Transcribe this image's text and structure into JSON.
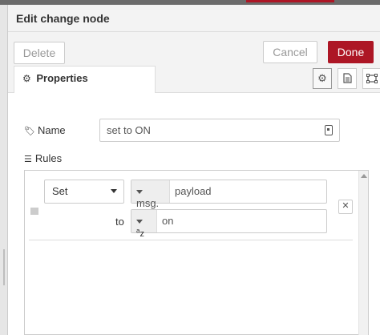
{
  "tray": {
    "title": "Edit change node"
  },
  "toolbar": {
    "delete_label": "Delete",
    "cancel_label": "Cancel",
    "done_label": "Done"
  },
  "tabs": {
    "properties_label": "Properties",
    "icons": [
      "gear-icon",
      "description-icon",
      "appearance-icon"
    ]
  },
  "form": {
    "name_label": "Name",
    "name_value": "set to ON",
    "rules_label": "Rules"
  },
  "rule": {
    "action": "Set",
    "target_type": "msg.",
    "target_value": "payload",
    "to_label": "to",
    "value_type": "az",
    "value": "on"
  },
  "colors": {
    "accent": "#ad1625",
    "tray_bg": "#f3f3f3",
    "border": "#cccccc"
  }
}
